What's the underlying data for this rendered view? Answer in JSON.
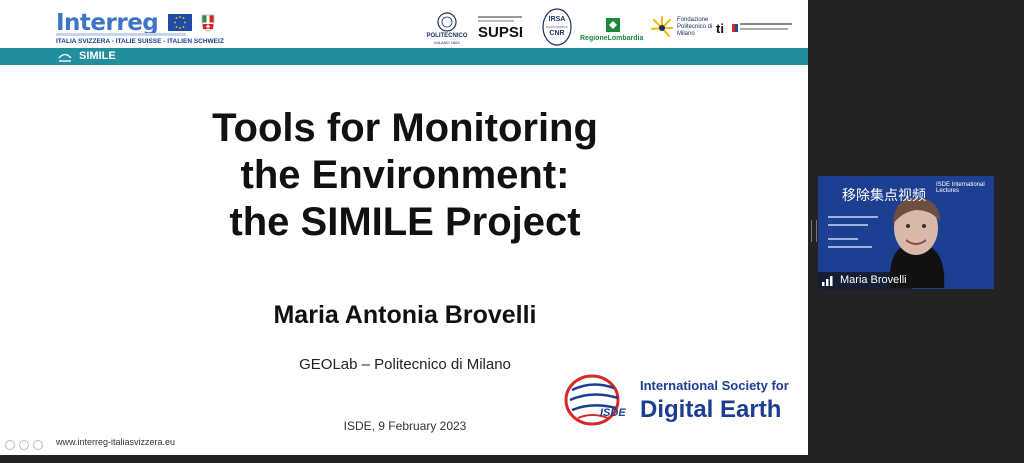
{
  "header": {
    "interreg_logo": "Interreg",
    "interreg_program": "ITALIA SVIZZERA - ITALIE SUISSE - ITALIEN SCHWEIZ",
    "partners": {
      "polimi": "POLITECNICO",
      "polimi_sub": "MILANO 1863",
      "supsi": "SUPSI",
      "irsa": "IRSA",
      "cnr": "CNR",
      "lombardia": "RegioneLombardia",
      "fondazione": "Fondazione Politecnico di Milano",
      "ti": "ti"
    }
  },
  "band": {
    "project_name": "SIMILE"
  },
  "slide": {
    "title_line1": "Tools for Monitoring",
    "title_line2": "the Environment:",
    "title_line3": "the SIMILE Project",
    "author": "Maria Antonia Brovelli",
    "affiliation": "GEOLab – Politecnico di Milano",
    "event": "ISDE, 9 February 2023",
    "website": "www.interreg-italiasvizzera.eu",
    "isde_line1": "International Society for",
    "isde_line2": "Digital Earth",
    "isde_mark": "ISDE"
  },
  "video": {
    "participant_name": "Maria Brovelli",
    "watermark": "移除集点视频",
    "bg_heading": "ISDE International Lectures"
  },
  "colors": {
    "band": "#238e9c",
    "isde_blue": "#1d3d91",
    "interreg_blue": "#3d74c7",
    "video_bg": "#1d3f91"
  }
}
